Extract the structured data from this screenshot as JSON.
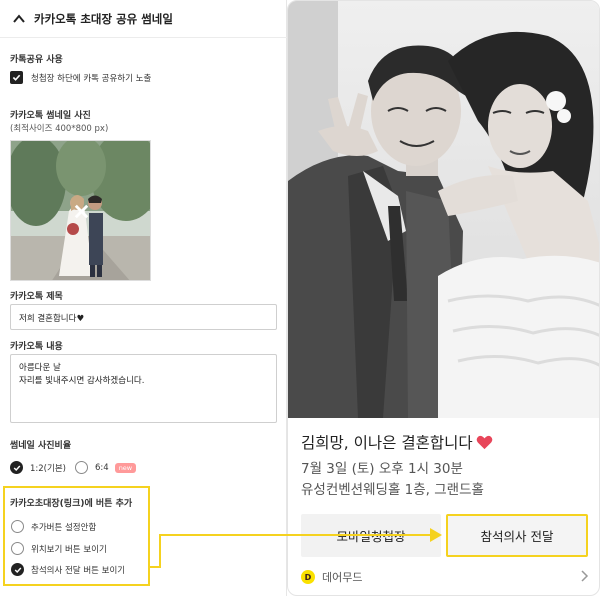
{
  "panel": {
    "header_title": "카카오톡 초대장 공유 썸네일",
    "share_section_label": "카톡공유 사용",
    "share_checkbox_label": "청첩장 하단에 카톡 공유하기 노출",
    "thumbnail_label": "카카오톡 썸네일 사진",
    "thumbnail_hint": "(최적사이즈 400*800 px)",
    "title_label": "카카오톡 제목",
    "title_value": "저희 결혼합니다♥",
    "content_label": "카카오톡 내용",
    "content_value": "아름다운 날\n자리를 빛내주시면 감사하겠습니다.",
    "ratio_label": "썸네일 사진비율",
    "ratio_options": [
      {
        "label": "1:2(기본)",
        "selected": true
      },
      {
        "label": "6:4",
        "selected": false,
        "badge": "new"
      }
    ],
    "button_section_label": "카카오초대장(링크)에 버튼 추가",
    "button_options": [
      {
        "label": "추가버튼 설정안함",
        "selected": false
      },
      {
        "label": "위치보기 버튼 보이기",
        "selected": false
      },
      {
        "label": "참석의사 전달 버튼 보이기",
        "selected": true
      }
    ]
  },
  "card": {
    "title": "김희망, 이나은 결혼합니다",
    "description": "7월 3일 (토) 오후 1시 30분\n유성컨벤션웨딩홀 1층, 그랜드홀",
    "button_left": "모바일청첩장",
    "button_right": "참석의사 전달",
    "footer_logo_glyph": "D",
    "footer_label": "데어무드"
  },
  "colors": {
    "highlight": "#f5d21f",
    "heart": "#e8465a",
    "kakao_yellow": "#fae100",
    "new_badge": "#ff9a9a"
  },
  "icons": [
    "chevron-up-icon",
    "checkbox-checked-icon",
    "remove-x-icon",
    "radio-checked-icon",
    "heart-icon",
    "kakao-logo-icon",
    "chevron-right-icon"
  ]
}
